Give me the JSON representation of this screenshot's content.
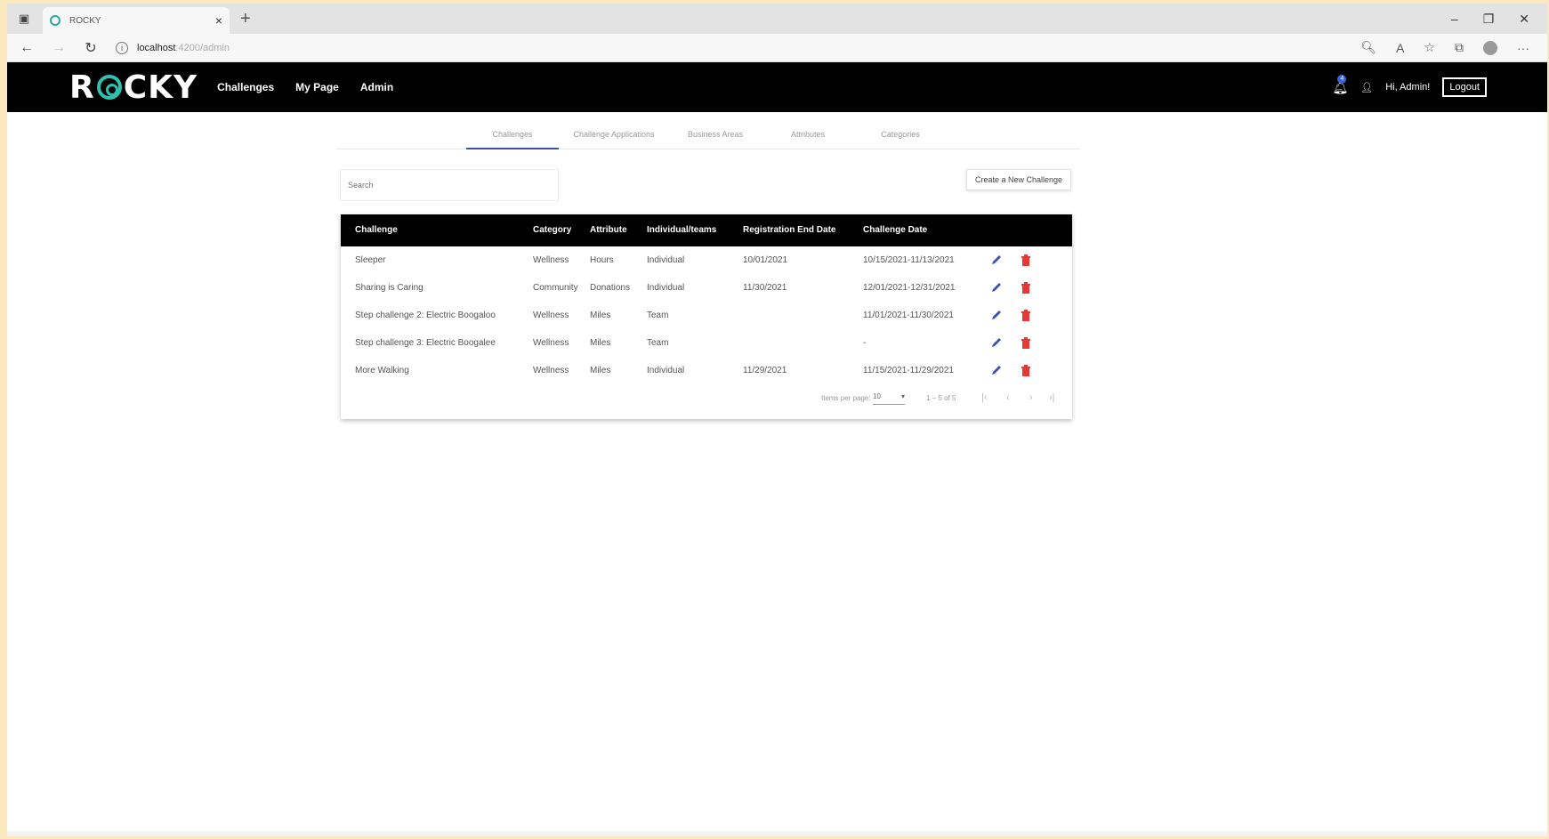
{
  "browser": {
    "tab_title": "ROCKY",
    "url_host": "localhost",
    "url_path": ":4200/admin"
  },
  "app": {
    "logo_left": "R",
    "logo_right": "CKY",
    "nav": [
      "Challenges",
      "My Page",
      "Admin"
    ],
    "notification_count": "4",
    "greeting": "Hi, Admin!",
    "logout_label": "Logout"
  },
  "admin_tabs": [
    "Challenges",
    "Challenge Applications",
    "Business Areas",
    "Attributes",
    "Categories"
  ],
  "search": {
    "placeholder": "Search"
  },
  "create_label": "Create a New Challenge",
  "table": {
    "headers": [
      "Challenge",
      "Category",
      "Attribute",
      "Individual/teams",
      "Registration End Date",
      "Challenge Date"
    ],
    "rows": [
      [
        "Sleeper",
        "Wellness",
        "Hours",
        "Individual",
        "10/01/2021",
        "10/15/2021-11/13/2021"
      ],
      [
        "Sharing is Caring",
        "Community",
        "Donations",
        "Individual",
        "11/30/2021",
        "12/01/2021-12/31/2021"
      ],
      [
        "Step challenge 2: Electric Boogaloo",
        "Wellness",
        "Miles",
        "Team",
        "",
        "11/01/2021-11/30/2021"
      ],
      [
        "Step challenge 3: Electric Boogalee",
        "Wellness",
        "Miles",
        "Team",
        "",
        "-"
      ],
      [
        "More Walking",
        "Wellness",
        "Miles",
        "Individual",
        "11/29/2021",
        "11/15/2021-11/29/2021"
      ]
    ]
  },
  "paginator": {
    "items_label": "Items per page:",
    "page_size": "10",
    "range": "1 – 5 of 5"
  },
  "colors": {
    "accent": "#3e4fb5",
    "delete": "#e53935",
    "brand": "#2dc2b0"
  }
}
